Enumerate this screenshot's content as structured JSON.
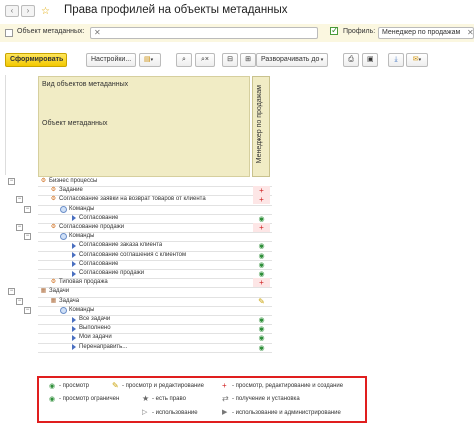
{
  "window": {
    "title": "Права профилей на объекты метаданных"
  },
  "filter": {
    "metadata_label": "Объект метаданных:",
    "metadata_value": "",
    "profile_label": "Профиль:",
    "profile_value": "Менеджер по продажам"
  },
  "toolbar": {
    "generate": "Сформировать",
    "settings": "Настройки...",
    "expand": "Разворачивать до"
  },
  "grid": {
    "header_top": "Вид объектов метаданных",
    "header_sub": "Объект метаданных",
    "column": "Менеджер по продажам",
    "rows": [
      {
        "label": "Бизнес процессы",
        "mark": "",
        "icon": "bp"
      },
      {
        "label": "Задание",
        "mark": "+",
        "icon": "bp"
      },
      {
        "label": "Согласование заявки на возврат товаров от клиента",
        "mark": "+",
        "icon": "bp"
      },
      {
        "label": "Команды",
        "mark": "",
        "icon": "circ"
      },
      {
        "label": "Согласование",
        "mark": "eye",
        "icon": "tri"
      },
      {
        "label": "Согласование продажи",
        "mark": "+",
        "icon": "bp"
      },
      {
        "label": "Команды",
        "mark": "",
        "icon": "circ"
      },
      {
        "label": "Согласование заказа клиента",
        "mark": "eye",
        "icon": "tri"
      },
      {
        "label": "Согласование соглашения с клиентом",
        "mark": "eye",
        "icon": "tri"
      },
      {
        "label": "Согласование",
        "mark": "eye",
        "icon": "tri"
      },
      {
        "label": "Согласование продажи",
        "mark": "eye",
        "icon": "tri"
      },
      {
        "label": "Типовая продажа",
        "mark": "+",
        "icon": "bp"
      },
      {
        "label": "Задачи",
        "mark": "",
        "icon": "task"
      },
      {
        "label": "Задача",
        "mark": "pencil",
        "icon": "task"
      },
      {
        "label": "Команды",
        "mark": "",
        "icon": "circ"
      },
      {
        "label": "Все задачи",
        "mark": "eye",
        "icon": "tri"
      },
      {
        "label": "Выполнено",
        "mark": "eye",
        "icon": "tri"
      },
      {
        "label": "Мои задачи",
        "mark": "eye",
        "icon": "tri"
      },
      {
        "label": "Перенаправить...",
        "mark": "eye",
        "icon": "tri"
      }
    ]
  },
  "legend": {
    "view": "- просмотр",
    "view_edit": "- просмотр и редактирование",
    "view_edit_create": "- просмотр, редактирование и создание",
    "view_limited": "- просмотр ограничен",
    "has_right": "- есть право",
    "receive_install": "- получение и установка",
    "use": "- использование",
    "use_admin": "- использование и администрирование"
  }
}
